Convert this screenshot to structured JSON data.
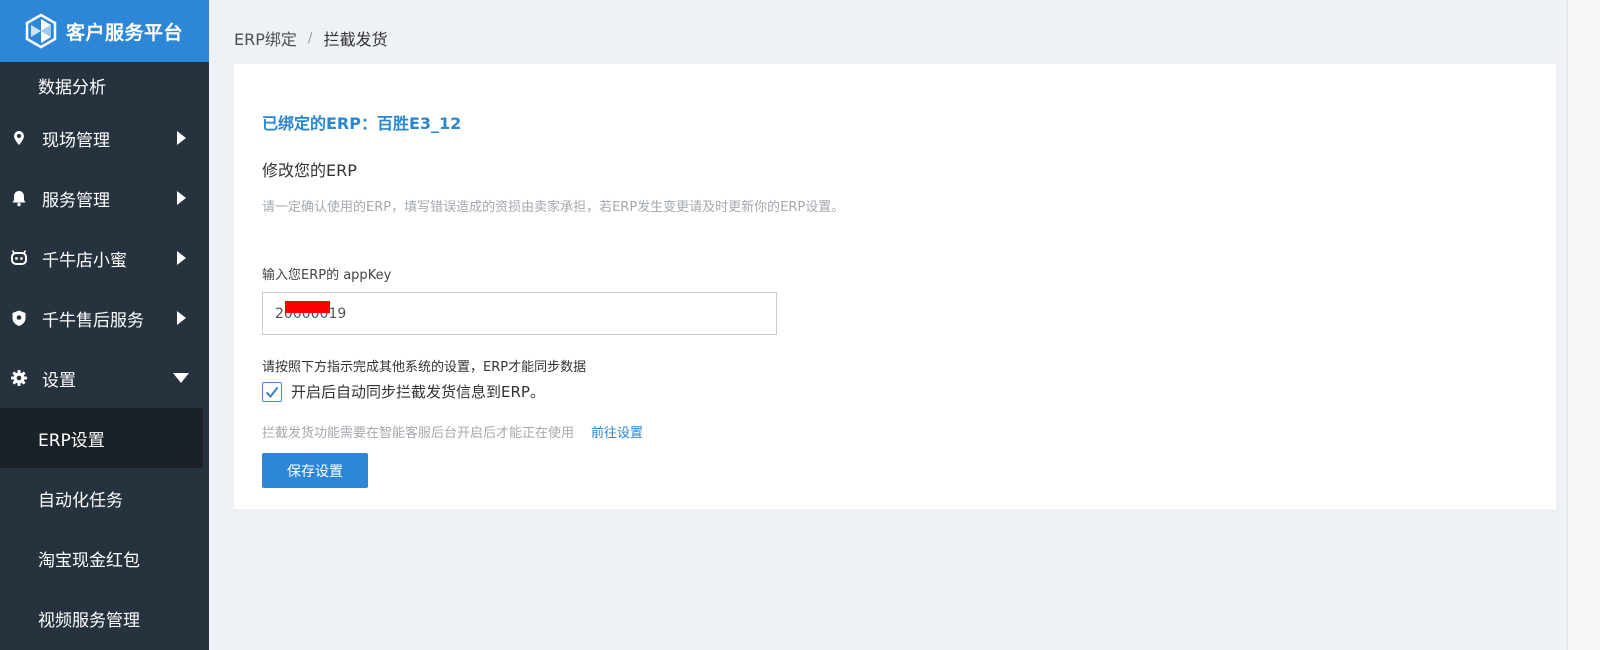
{
  "brand": {
    "name": "客户服务平台"
  },
  "sidebar": {
    "items": [
      {
        "label": "数据分析"
      },
      {
        "label": "现场管理",
        "icon": "location-pin-icon"
      },
      {
        "label": "服务管理",
        "icon": "bell-icon"
      },
      {
        "label": "千牛店小蜜",
        "icon": "robot-icon"
      },
      {
        "label": "千牛售后服务",
        "icon": "shield-icon"
      },
      {
        "label": "设置",
        "icon": "gear-icon"
      }
    ],
    "sub_items": [
      {
        "label": "ERP设置",
        "active": true
      },
      {
        "label": "自动化任务"
      },
      {
        "label": "淘宝现金红包"
      },
      {
        "label": "视频服务管理"
      }
    ]
  },
  "breadcrumb": {
    "parent": "ERP绑定",
    "separator": "/",
    "current": "拦截发货"
  },
  "main": {
    "bound_title": "已绑定的ERP：百胜E3_12",
    "modify_title": "修改您的ERP",
    "description": "请一定确认使用的ERP，填写错误造成的资损由卖家承担，若ERP发生变更请及时更新你的ERP设置。",
    "appkey_label": "输入您ERP的 appKey",
    "appkey_value": "20000019",
    "sync_note": "请按照下方指示完成其他系统的设置，ERP才能同步数据",
    "checkbox_label": "开启后自动同步拦截发货信息到ERP。",
    "checkbox_checked": true,
    "hint_text": "拦截发货功能需要在智能客服后台开启后才能正在使用",
    "hint_link": "前往设置",
    "save_button": "保存设置"
  },
  "colors": {
    "sidebar_bg": "#26323d",
    "brand_bg": "#2d87d6",
    "active_bg": "#1a2128",
    "accent": "#2b86d0",
    "page_bg": "#eef1f6"
  }
}
